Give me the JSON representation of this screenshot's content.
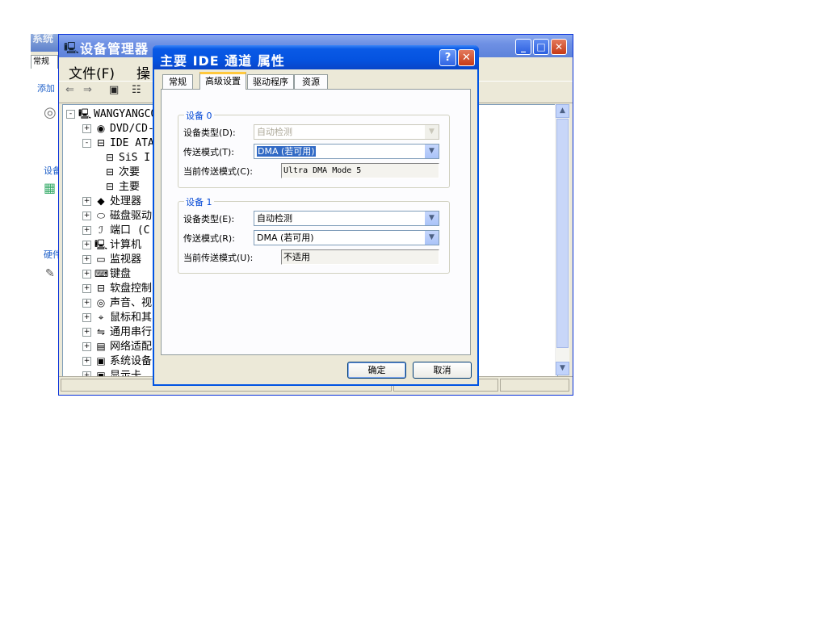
{
  "bg_window": {
    "title": "系统",
    "tab_label": "常规",
    "fragments": [
      "添加",
      "设备",
      "硬件"
    ]
  },
  "device_manager": {
    "title": "设备管理器",
    "menu": {
      "file": "文件(F)",
      "action": "操"
    },
    "tree": [
      {
        "label": "WANGYANGCO",
        "icon": "computer-icon",
        "expander": "-",
        "level": 0
      },
      {
        "label": "DVD/CD-",
        "icon": "dvd-drive-icon",
        "expander": "+",
        "level": 1
      },
      {
        "label": "IDE ATA",
        "icon": "ide-controller-icon",
        "expander": "-",
        "level": 1
      },
      {
        "label": "SiS I",
        "icon": "ide-channel-icon",
        "expander": "",
        "level": 2
      },
      {
        "label": "次要",
        "icon": "ide-channel-icon",
        "expander": "",
        "level": 2
      },
      {
        "label": "主要",
        "icon": "ide-channel-icon",
        "expander": "",
        "level": 2
      },
      {
        "label": "处理器",
        "icon": "processor-icon",
        "expander": "+",
        "level": 1
      },
      {
        "label": "磁盘驱动",
        "icon": "disk-drive-icon",
        "expander": "+",
        "level": 1
      },
      {
        "label": "端口 (C",
        "icon": "port-icon",
        "expander": "+",
        "level": 1
      },
      {
        "label": "计算机",
        "icon": "computer-icon",
        "expander": "+",
        "level": 1
      },
      {
        "label": "监视器",
        "icon": "monitor-icon",
        "expander": "+",
        "level": 1
      },
      {
        "label": "键盘",
        "icon": "keyboard-icon",
        "expander": "+",
        "level": 1
      },
      {
        "label": "软盘控制",
        "icon": "floppy-controller-icon",
        "expander": "+",
        "level": 1
      },
      {
        "label": "声音、视",
        "icon": "sound-icon",
        "expander": "+",
        "level": 1
      },
      {
        "label": "鼠标和其",
        "icon": "mouse-icon",
        "expander": "+",
        "level": 1
      },
      {
        "label": "通用串行",
        "icon": "usb-icon",
        "expander": "+",
        "level": 1
      },
      {
        "label": "网络适配",
        "icon": "network-adapter-icon",
        "expander": "+",
        "level": 1
      },
      {
        "label": "系统设备",
        "icon": "system-device-icon",
        "expander": "+",
        "level": 1
      },
      {
        "label": "显示卡",
        "icon": "display-adapter-icon",
        "expander": "+",
        "level": 1
      }
    ]
  },
  "dialog": {
    "title": "主要 IDE 通道 属性",
    "help_glyph": "?",
    "close_glyph": "✕",
    "tabs": [
      {
        "label": "常规",
        "active": false
      },
      {
        "label": "高级设置",
        "active": true
      },
      {
        "label": "驱动程序",
        "active": false
      },
      {
        "label": "资源",
        "active": false
      }
    ],
    "device0": {
      "legend": "设备 0",
      "device_type_label": "设备类型(D):",
      "device_type_value": "自动检测",
      "device_type_disabled": true,
      "transfer_mode_label": "传送模式(T):",
      "transfer_mode_value": "DMA (若可用)",
      "current_mode_label": "当前传送模式(C):",
      "current_mode_value": "Ultra DMA Mode 5"
    },
    "device1": {
      "legend": "设备 1",
      "device_type_label": "设备类型(E):",
      "device_type_value": "自动检测",
      "transfer_mode_label": "传送模式(R):",
      "transfer_mode_value": "DMA (若可用)",
      "current_mode_label": "当前传送模式(U):",
      "current_mode_value": "不适用"
    },
    "ok_label": "确定",
    "cancel_label": "取消"
  },
  "colors": {
    "xp_blue_title": "#0553e0",
    "dialog_face": "#ece9d8",
    "group_legend": "#0046d5",
    "selection": "#316ac5",
    "tab_highlight": "#ffc83c"
  }
}
